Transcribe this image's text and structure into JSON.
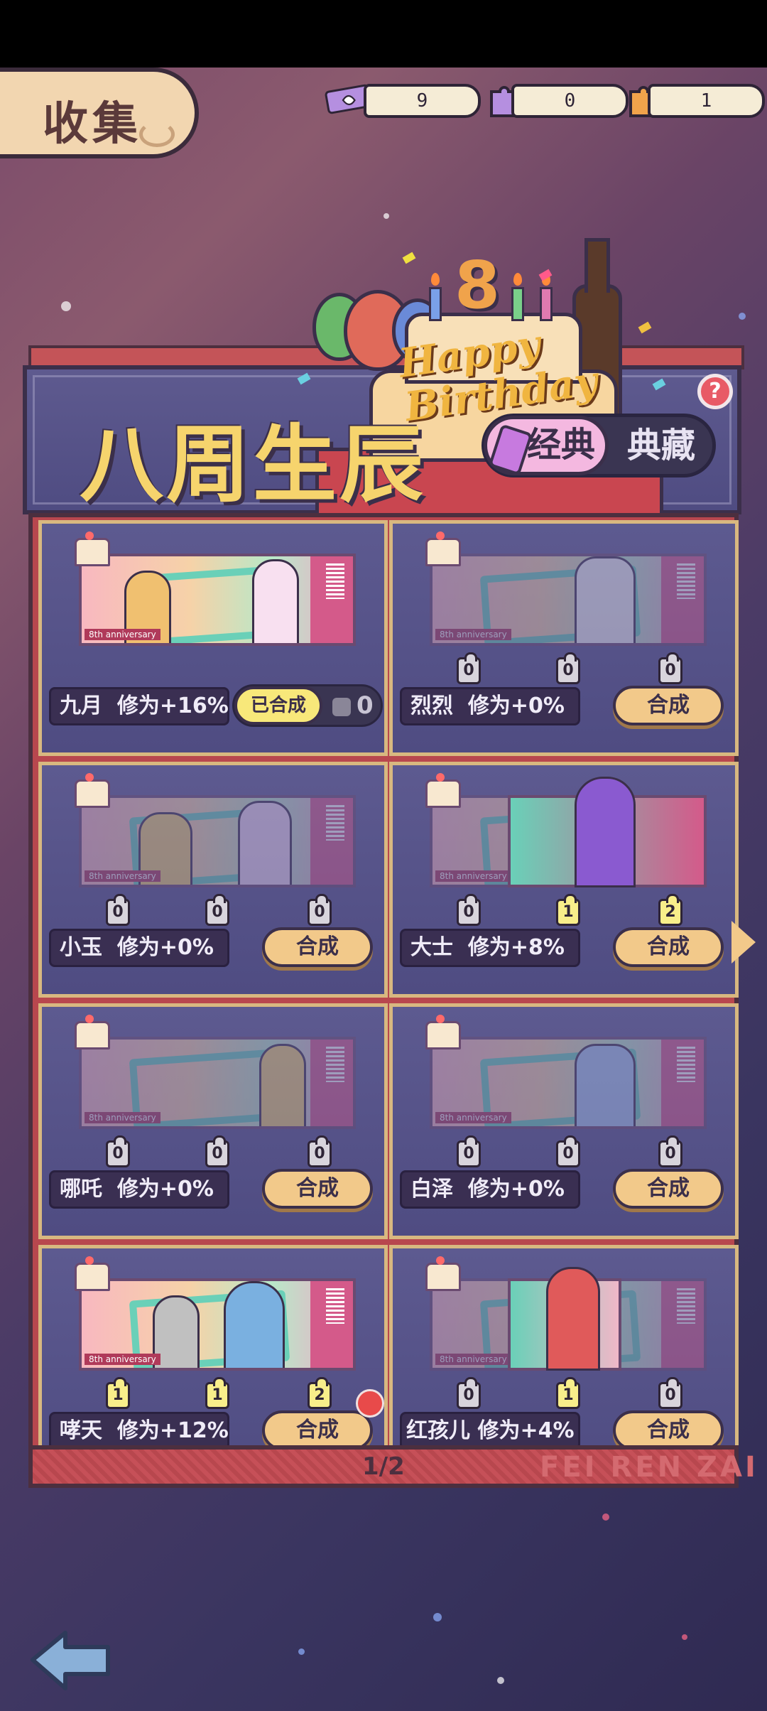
{
  "header": {
    "title": "收集"
  },
  "currencies": [
    {
      "icon": "ticket-icon",
      "value": "9"
    },
    {
      "icon": "purple-puzzle-icon",
      "value": "0"
    },
    {
      "icon": "orange-puzzle-icon",
      "value": "1"
    }
  ],
  "banner": {
    "title": "八周生辰",
    "cake_number": "8",
    "cake_text": "Happy Birthday",
    "toggle": {
      "active": "经典",
      "inactive": "典藏"
    },
    "help": "?"
  },
  "cards": [
    {
      "name": "九月",
      "bonus": "修为+16%",
      "status": "已合成",
      "owned_count": "0",
      "pieces": [],
      "anniv": "8th anniversary"
    },
    {
      "name": "烈烈",
      "bonus": "修为+0%",
      "button": "合成",
      "pieces": [
        "0",
        "0",
        "0"
      ],
      "anniv": "8th anniversary"
    },
    {
      "name": "小玉",
      "bonus": "修为+0%",
      "button": "合成",
      "pieces": [
        "0",
        "0",
        "0"
      ],
      "anniv": "8th anniversary"
    },
    {
      "name": "大士",
      "bonus": "修为+8%",
      "button": "合成",
      "pieces": [
        "0",
        "1",
        "2"
      ],
      "anniv": "8th anniversary"
    },
    {
      "name": "哪吒",
      "bonus": "修为+0%",
      "button": "合成",
      "pieces": [
        "0",
        "0",
        "0"
      ],
      "anniv": "8th anniversary"
    },
    {
      "name": "白泽",
      "bonus": "修为+0%",
      "button": "合成",
      "pieces": [
        "0",
        "0",
        "0"
      ],
      "anniv": "8th anniversary"
    },
    {
      "name": "哮天",
      "bonus": "修为+12%",
      "button": "合成",
      "pieces": [
        "1",
        "1",
        "2"
      ],
      "anniv": "8th anniversary"
    },
    {
      "name": "红孩儿",
      "bonus": "修为+4%",
      "button": "合成",
      "pieces": [
        "0",
        "1",
        "0"
      ],
      "anniv": "8th anniversary"
    }
  ],
  "pagination": {
    "label": "1/2"
  },
  "watermark": "FEI REN ZAI",
  "colors": {
    "accent": "#f2c98a",
    "panel": "#b8474e",
    "card": "#5d5a90",
    "title_gold": "#f6d46d"
  }
}
